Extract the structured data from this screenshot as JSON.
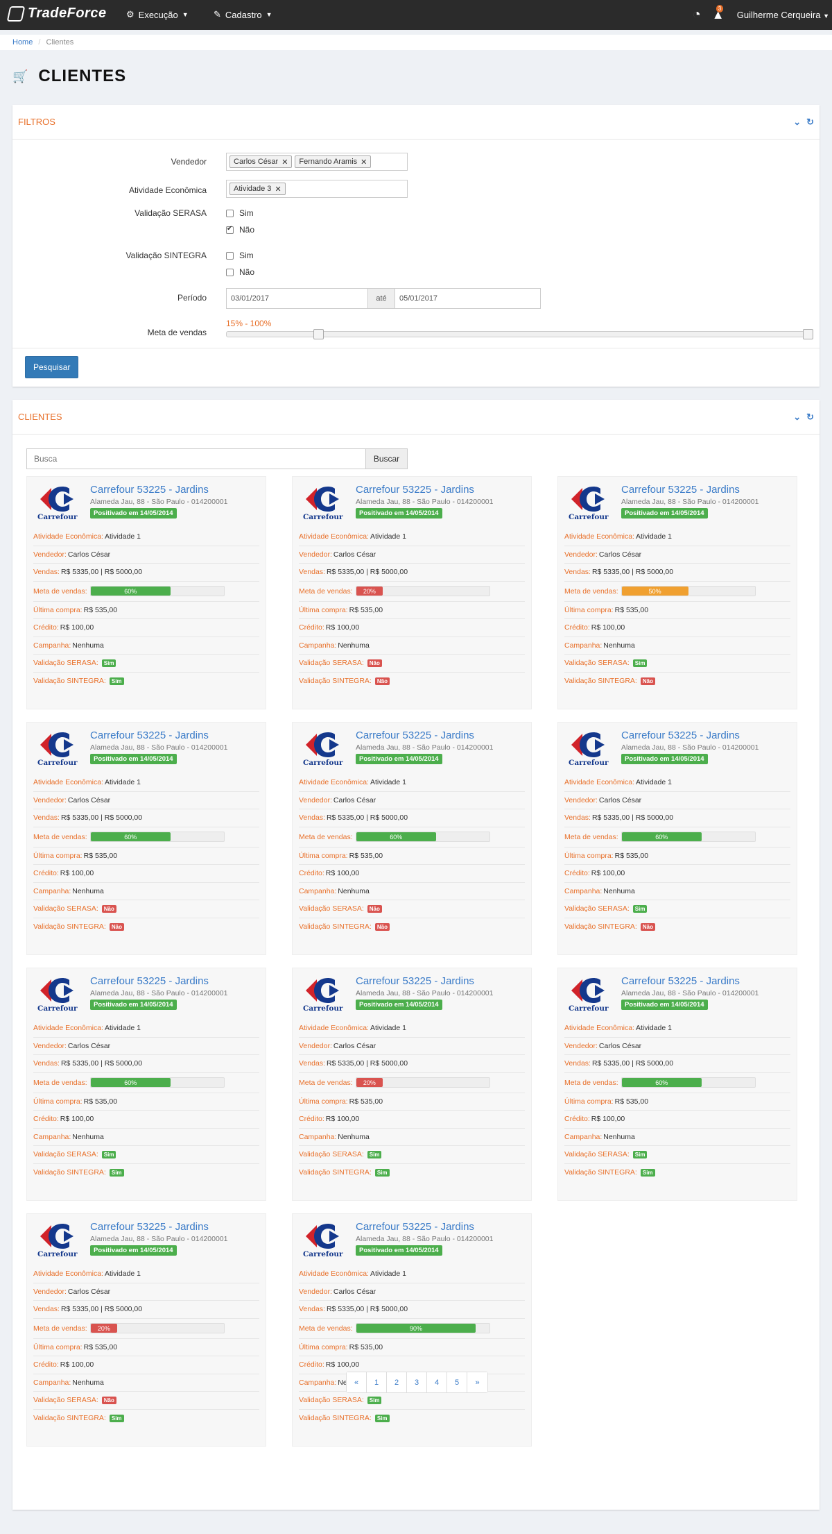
{
  "app": {
    "name": "TradeForce"
  },
  "nav": {
    "items": [
      {
        "label": "Execução"
      },
      {
        "label": "Cadastro"
      }
    ]
  },
  "user": {
    "name": "Guilherme Cerqueira",
    "notifications": "3"
  },
  "breadcrumb": {
    "home": "Home",
    "separator": "/",
    "current": "Clientes"
  },
  "page": {
    "title": "CLIENTES"
  },
  "filters": {
    "title": "FILTROS",
    "vendedor_label": "Vendedor",
    "vendedor_tags": [
      "Carlos César",
      "Fernando Aramis"
    ],
    "atividade_label": "Atividade Econômica",
    "atividade_tags": [
      "Atividade 3"
    ],
    "serasa_label": "Validação SERASA",
    "sintegra_label": "Validação SINTEGRA",
    "opt_sim": "Sim",
    "opt_nao": "Não",
    "serasa": {
      "sim": false,
      "nao": true
    },
    "sintegra": {
      "sim": false,
      "nao": false
    },
    "periodo_label": "Período",
    "date_from": "03/01/2017",
    "date_sep": "até",
    "date_to": "05/01/2017",
    "meta_label": "Meta de vendas",
    "meta_range_text": "15% - 100%",
    "meta_min": 15,
    "meta_max": 100,
    "search_button": "Pesquisar"
  },
  "clients_panel": {
    "title": "CLIENTES",
    "search_placeholder": "Busca",
    "search_button": "Buscar"
  },
  "card_labels": {
    "atividade": "Atividade Econômica:",
    "vendedor": "Vendedor:",
    "vendas": "Vendas:",
    "meta": "Meta de vendas:",
    "ultima": "Última compra:",
    "credito": "Crédito:",
    "campanha": "Campanha:",
    "serasa": "Validação SERASA:",
    "sintegra": "Validação SINTEGRA:"
  },
  "status_words": {
    "yes": "Sim",
    "no": "Não"
  },
  "colors": {
    "green": "#4cae4c",
    "red": "#d9534f",
    "orange": "#f0a030",
    "accent": "#e8702a",
    "link": "#3a7bc8"
  },
  "cards": [
    {
      "title": "Carrefour 53225 - Jardins",
      "address": "Alameda Jau, 88 - São Paulo - 014200001",
      "badge": "Positivado em 14/05/2014",
      "logo_text": "Carrefour",
      "atividade": "Atividade 1",
      "vendedor": "Carlos César",
      "vendas": "R$ 5335,00 | R$ 5000,00",
      "meta_pct": 60,
      "meta_text": "60%",
      "meta_color": "green",
      "ultima": "R$ 535,00",
      "credito": "R$ 100,00",
      "campanha": "Nenhuma",
      "serasa": "yes",
      "sintegra": "yes"
    },
    {
      "title": "Carrefour 53225 - Jardins",
      "address": "Alameda Jau, 88 - São Paulo - 014200001",
      "badge": "Positivado em 14/05/2014",
      "logo_text": "Carrefour",
      "atividade": "Atividade 1",
      "vendedor": "Carlos César",
      "vendas": "R$ 5335,00 | R$ 5000,00",
      "meta_pct": 20,
      "meta_text": "20%",
      "meta_color": "red",
      "ultima": "R$ 535,00",
      "credito": "R$ 100,00",
      "campanha": "Nenhuma",
      "serasa": "no",
      "sintegra": "no"
    },
    {
      "title": "Carrefour 53225 - Jardins",
      "address": "Alameda Jau, 88 - São Paulo - 014200001",
      "badge": "Positivado em 14/05/2014",
      "logo_text": "Carrefour",
      "atividade": "Atividade 1",
      "vendedor": "Carlos César",
      "vendas": "R$ 5335,00 | R$ 5000,00",
      "meta_pct": 50,
      "meta_text": "50%",
      "meta_color": "orange",
      "ultima": "R$ 535,00",
      "credito": "R$ 100,00",
      "campanha": "Nenhuma",
      "serasa": "yes",
      "sintegra": "no"
    },
    {
      "title": "Carrefour 53225 - Jardins",
      "address": "Alameda Jau, 88 - São Paulo - 014200001",
      "badge": "Positivado em 14/05/2014",
      "logo_text": "Carrefour",
      "atividade": "Atividade 1",
      "vendedor": "Carlos César",
      "vendas": "R$ 5335,00 | R$ 5000,00",
      "meta_pct": 60,
      "meta_text": "60%",
      "meta_color": "green",
      "ultima": "R$ 535,00",
      "credito": "R$ 100,00",
      "campanha": "Nenhuma",
      "serasa": "no",
      "sintegra": "no"
    },
    {
      "title": "Carrefour 53225 - Jardins",
      "address": "Alameda Jau, 88 - São Paulo - 014200001",
      "badge": "Positivado em 14/05/2014",
      "logo_text": "Carrefour",
      "atividade": "Atividade 1",
      "vendedor": "Carlos César",
      "vendas": "R$ 5335,00 | R$ 5000,00",
      "meta_pct": 60,
      "meta_text": "60%",
      "meta_color": "green",
      "ultima": "R$ 535,00",
      "credito": "R$ 100,00",
      "campanha": "Nenhuma",
      "serasa": "no",
      "sintegra": "no"
    },
    {
      "title": "Carrefour 53225 - Jardins",
      "address": "Alameda Jau, 88 - São Paulo - 014200001",
      "badge": "Positivado em 14/05/2014",
      "logo_text": "Carrefour",
      "atividade": "Atividade 1",
      "vendedor": "Carlos César",
      "vendas": "R$ 5335,00 | R$ 5000,00",
      "meta_pct": 60,
      "meta_text": "60%",
      "meta_color": "green",
      "ultima": "R$ 535,00",
      "credito": "R$ 100,00",
      "campanha": "Nenhuma",
      "serasa": "yes",
      "sintegra": "no"
    },
    {
      "title": "Carrefour 53225 - Jardins",
      "address": "Alameda Jau, 88 - São Paulo - 014200001",
      "badge": "Positivado em 14/05/2014",
      "logo_text": "Carrefour",
      "atividade": "Atividade 1",
      "vendedor": "Carlos César",
      "vendas": "R$ 5335,00 | R$ 5000,00",
      "meta_pct": 60,
      "meta_text": "60%",
      "meta_color": "green",
      "ultima": "R$ 535,00",
      "credito": "R$ 100,00",
      "campanha": "Nenhuma",
      "serasa": "yes",
      "sintegra": "yes"
    },
    {
      "title": "Carrefour 53225 - Jardins",
      "address": "Alameda Jau, 88 - São Paulo - 014200001",
      "badge": "Positivado em 14/05/2014",
      "logo_text": "Carrefour",
      "atividade": "Atividade 1",
      "vendedor": "Carlos César",
      "vendas": "R$ 5335,00 | R$ 5000,00",
      "meta_pct": 20,
      "meta_text": "20%",
      "meta_color": "red",
      "ultima": "R$ 535,00",
      "credito": "R$ 100,00",
      "campanha": "Nenhuma",
      "serasa": "yes",
      "sintegra": "yes"
    },
    {
      "title": "Carrefour 53225 - Jardins",
      "address": "Alameda Jau, 88 - São Paulo - 014200001",
      "badge": "Positivado em 14/05/2014",
      "logo_text": "Carrefour",
      "atividade": "Atividade 1",
      "vendedor": "Carlos César",
      "vendas": "R$ 5335,00 | R$ 5000,00",
      "meta_pct": 60,
      "meta_text": "60%",
      "meta_color": "green",
      "ultima": "R$ 535,00",
      "credito": "R$ 100,00",
      "campanha": "Nenhuma",
      "serasa": "yes",
      "sintegra": "yes"
    },
    {
      "title": "Carrefour 53225 - Jardins",
      "address": "Alameda Jau, 88 - São Paulo - 014200001",
      "badge": "Positivado em 14/05/2014",
      "logo_text": "Carrefour",
      "atividade": "Atividade 1",
      "vendedor": "Carlos César",
      "vendas": "R$ 5335,00 | R$ 5000,00",
      "meta_pct": 20,
      "meta_text": "20%",
      "meta_color": "red",
      "ultima": "R$ 535,00",
      "credito": "R$ 100,00",
      "campanha": "Nenhuma",
      "serasa": "no",
      "sintegra": "yes"
    },
    {
      "title": "Carrefour 53225 - Jardins",
      "address": "Alameda Jau, 88 - São Paulo - 014200001",
      "badge": "Positivado em 14/05/2014",
      "logo_text": "Carrefour",
      "atividade": "Atividade 1",
      "vendedor": "Carlos César",
      "vendas": "R$ 5335,00 | R$ 5000,00",
      "meta_pct": 90,
      "meta_text": "90%",
      "meta_color": "green",
      "ultima": "R$ 535,00",
      "credito": "R$ 100,00",
      "campanha": "Nenhuma",
      "serasa": "yes",
      "sintegra": "yes"
    }
  ],
  "pagination": {
    "prev": "«",
    "pages": [
      "1",
      "2",
      "3",
      "4",
      "5"
    ],
    "next": "»"
  }
}
